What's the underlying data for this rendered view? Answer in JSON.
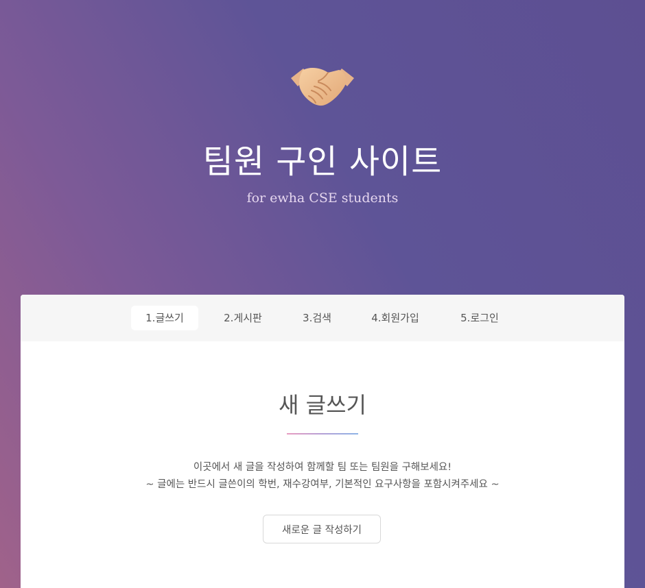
{
  "header": {
    "logo_icon": "handshake-icon",
    "title": "팀원 구인 사이트",
    "subtitle": "for ewha CSE students"
  },
  "nav": {
    "items": [
      {
        "label": "1.글쓰기",
        "active": true
      },
      {
        "label": "2.게시판",
        "active": false
      },
      {
        "label": "3.검색",
        "active": false
      },
      {
        "label": "4.회원가입",
        "active": false
      },
      {
        "label": "5.로그인",
        "active": false
      }
    ]
  },
  "main": {
    "title": "새 글쓰기",
    "description_line1": "이곳에서 새 글을 작성하여 함께할 팀 또는 팀원을 구해보세요!",
    "description_line2": "~ 글에는 반드시 글쓴이의 학번, 재수강여부, 기본적인 요구사항을 포함시켜주세요 ~",
    "button_label": "새로운 글 작성하기"
  },
  "colors": {
    "gradient_pink": "#a0628a",
    "gradient_purple": "#5d4f92",
    "divider_start": "#e89bc0",
    "divider_end": "#8cb3e6"
  }
}
